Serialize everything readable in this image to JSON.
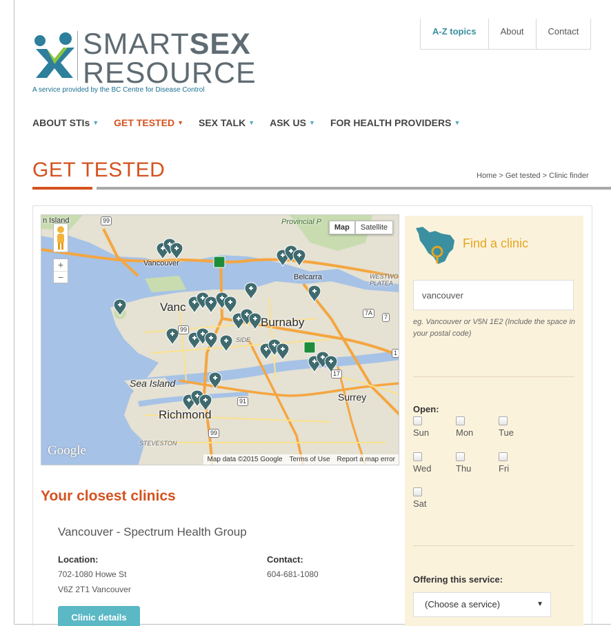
{
  "topnav": [
    {
      "label": "A-Z topics",
      "active": true
    },
    {
      "label": "About",
      "active": false
    },
    {
      "label": "Contact",
      "active": false
    }
  ],
  "logo": {
    "line1_a": "SMART",
    "line1_b": "SEX",
    "line2": "RESOURCE",
    "tagline": "A service provided by the BC Centre for Disease Control"
  },
  "mainnav": [
    {
      "label": "ABOUT STIs",
      "active": false
    },
    {
      "label": "GET TESTED",
      "active": true
    },
    {
      "label": "SEX TALK",
      "active": false
    },
    {
      "label": "ASK US",
      "active": false
    },
    {
      "label": "FOR HEALTH PROVIDERS",
      "active": false
    }
  ],
  "page": {
    "title": "GET TESTED",
    "breadcrumb": "Home > Get tested > Clinic finder"
  },
  "map": {
    "type_map": "Map",
    "type_satellite": "Satellite",
    "google": "Google",
    "footer": [
      "Map data ©2015 Google",
      "Terms of Use",
      "Report a map error"
    ],
    "labels": {
      "island": "n Island",
      "provincial": "Provincial P",
      "north_vancouver": "Vancouver",
      "vancouver": "Vanc",
      "belcarra": "Belcarra",
      "westwood": "WESTWO",
      "plateau": "PLATEA",
      "burnaby": "Burnaby",
      "side": "SIDE",
      "sea_island": "Sea Island",
      "richmond": "Richmond",
      "steveston": "STEVESTON",
      "surrey": "Surrey"
    },
    "shields": [
      "99",
      "99",
      "99",
      "91",
      "7A",
      "7",
      "17",
      "1"
    ]
  },
  "sidebar": {
    "find_title": "Find a clinic",
    "search_value": "vancouver",
    "hint": "eg. Vancouver or V5N 1E2 (Include the space in your postal code)",
    "open_label": "Open:",
    "days": [
      "Sun",
      "Mon",
      "Tue",
      "Wed",
      "Thu",
      "Fri",
      "Sat"
    ],
    "offer_label": "Offering this service:",
    "service_value": "(Choose a service)"
  },
  "results": {
    "title": "Your closest clinics",
    "clinic": {
      "name": "Vancouver - Spectrum Health Group",
      "location_label": "Location:",
      "address1": "702-1080 Howe St",
      "address2": "V6Z 2T1 Vancouver",
      "contact_label": "Contact:",
      "phone": "604-681-1080",
      "details_button": "Clinic details"
    }
  },
  "colors": {
    "accent": "#d4521f",
    "teal": "#5bb8c5",
    "link_blue": "#3a8fa0",
    "sidebar_bg": "#fbf2dc",
    "find_gold": "#e5a520",
    "marker": "#3f6b6f"
  }
}
